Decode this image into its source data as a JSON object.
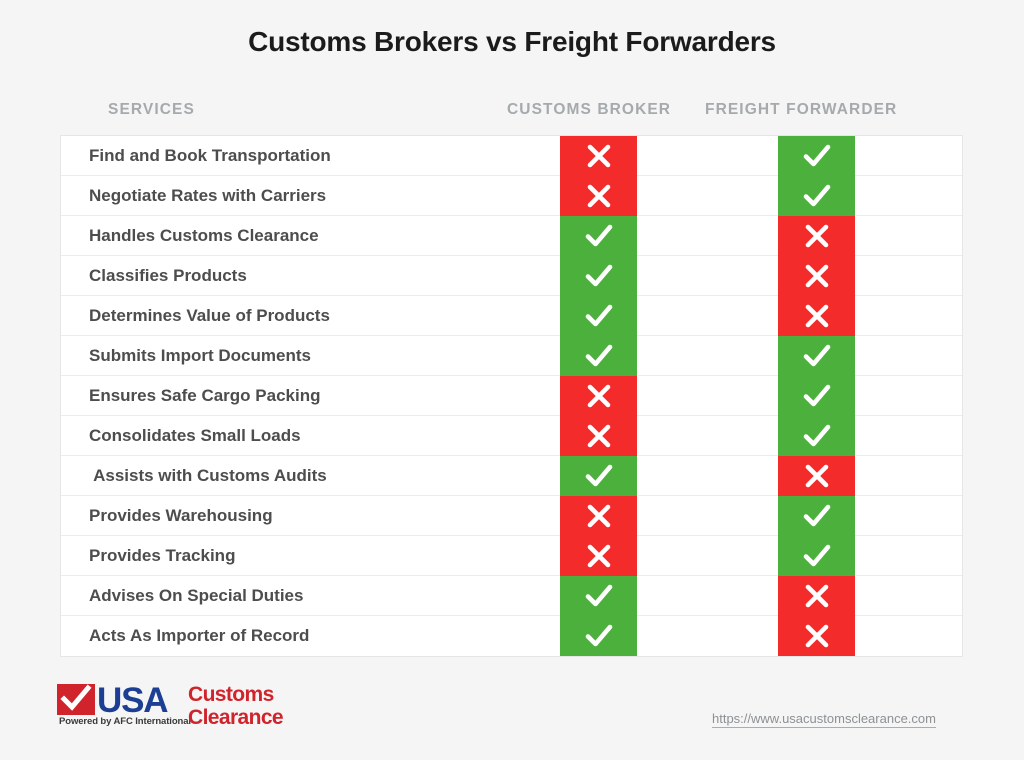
{
  "page": {
    "title": "Customs Brokers vs Freight Forwarders",
    "background_color": "#f5f5f5"
  },
  "colors": {
    "yes": "#4cb03d",
    "no": "#f42b2b",
    "title_text": "#1b1b1b",
    "header_text": "#a5aaad",
    "row_text": "#4d4d4d",
    "logo_red": "#d0232b",
    "logo_navy": "#1c3f94",
    "url_text": "#8d9194"
  },
  "table": {
    "headers": {
      "services": "SERVICES",
      "broker": "CUSTOMS BROKER",
      "forwarder": "FREIGHT FORWARDER"
    },
    "icons": {
      "yes": "check-icon",
      "no": "cross-icon"
    },
    "rows": [
      {
        "service": "Find and Book Transportation",
        "broker": "no",
        "forwarder": "yes"
      },
      {
        "service": "Negotiate Rates with Carriers",
        "broker": "no",
        "forwarder": "yes"
      },
      {
        "service": "Handles Customs Clearance",
        "broker": "yes",
        "forwarder": "no"
      },
      {
        "service": "Classifies Products",
        "broker": "yes",
        "forwarder": "no"
      },
      {
        "service": "Determines Value of Products",
        "broker": "yes",
        "forwarder": "no"
      },
      {
        "service": "Submits Import Documents",
        "broker": "yes",
        "forwarder": "yes"
      },
      {
        "service": "Ensures Safe Cargo Packing",
        "broker": "no",
        "forwarder": "yes"
      },
      {
        "service": "Consolidates Small Loads",
        "broker": "no",
        "forwarder": "yes"
      },
      {
        "service": " Assists with Customs Audits",
        "broker": "yes",
        "forwarder": "no"
      },
      {
        "service": "Provides Warehousing",
        "broker": "no",
        "forwarder": "yes"
      },
      {
        "service": "Provides Tracking",
        "broker": "no",
        "forwarder": "yes"
      },
      {
        "service": "Advises On Special Duties",
        "broker": "yes",
        "forwarder": "no"
      },
      {
        "service": "Acts As Importer of Record",
        "broker": "yes",
        "forwarder": "no"
      }
    ]
  },
  "footer": {
    "logo": {
      "mark": "USA",
      "tagline": "Powered by AFC International",
      "line1": "Customs",
      "line2": "Clearance"
    },
    "url": "https://www.usacustomsclearance.com"
  }
}
